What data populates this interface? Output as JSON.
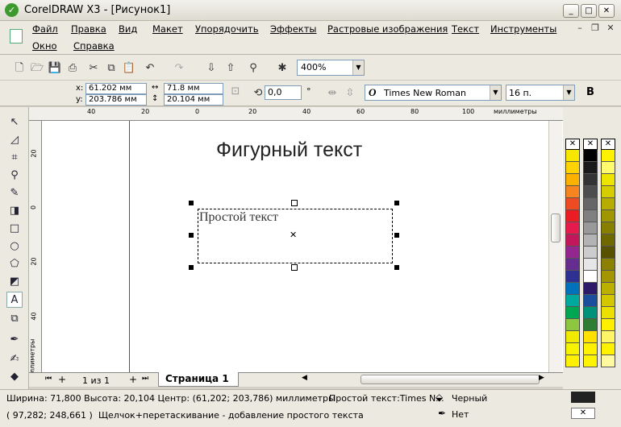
{
  "window": {
    "title": "CorelDRAW X3 - [Рисунок1]",
    "minimize": "_",
    "maximize": "□",
    "close": "✕"
  },
  "menu": [
    "Файл",
    "Правка",
    "Вид",
    "Макет",
    "Упорядочить",
    "Эффекты",
    "Растровые изображения",
    "Текст",
    "Инструменты",
    "Окно",
    "Справка"
  ],
  "toolbar": {
    "zoom": "400%"
  },
  "properties": {
    "x_label": "x:",
    "x": "61.202 мм",
    "y_label": "y:",
    "y": "203.786 мм",
    "w": "71.8 мм",
    "h": "20.104 мм",
    "angle": "0,0",
    "degree": "°",
    "font": "Times New Roman",
    "font_size": "16 п.",
    "bold": "B"
  },
  "ruler_top": {
    "ticks": [
      "40",
      "20",
      "0",
      "20",
      "40",
      "60",
      "80",
      "100"
    ],
    "unit": "миллиметры"
  },
  "ruler_left": {
    "ticks": [
      "20",
      "0",
      "20",
      "40"
    ],
    "unit": "миллиметры"
  },
  "document": {
    "artistic_text": "Фигурный текст",
    "paragraph_text": "Простой текст"
  },
  "pages": {
    "counter": "1 из 1",
    "tab": "Страница 1"
  },
  "status": {
    "line1": "Ширина: 71,800  Высота: 20,104  Центр: (61,202; 203,786)  миллиметры",
    "object": "Простой текст:Times N...",
    "fill": "Черный",
    "line2": "( 97,282; 248,661 )",
    "hint": "Щелчок+перетаскивание - добавление простого текста",
    "outline": "Нет"
  },
  "palette_colors": [
    [
      "#f7e600",
      "#ffd200",
      "#fbb100",
      "#f6841f",
      "#ef4b23",
      "#ec1c24",
      "#e51a4d",
      "#c2185b",
      "#93278f",
      "#662d91",
      "#2e3192",
      "#0072bc",
      "#00a99d",
      "#00a651",
      "#8dc63f",
      "#f2e900",
      "#f7f300",
      "#fff100"
    ],
    [
      "#000000",
      "#1a1a1a",
      "#333333",
      "#4d4d4d",
      "#666666",
      "#808080",
      "#999999",
      "#b3b3b3",
      "#cccccc",
      "#e6e6e6",
      "#ffffff",
      "#2e1a6b",
      "#1b4f9c",
      "#00917a",
      "#2e7d32",
      "#ffe100",
      "#fff200",
      "#fff400"
    ],
    [
      "#fff200",
      "#fffa6e",
      "#ede400",
      "#d6cd00",
      "#b7ad00",
      "#9f9600",
      "#877f00",
      "#6f6800",
      "#575100",
      "#8b8000",
      "#a39600",
      "#bbb000",
      "#d3c700",
      "#ebe000",
      "#fff000",
      "#fff566",
      "#fff200",
      "#fff9a0"
    ]
  ],
  "colors": {
    "canvas": "#ffffff",
    "chrome": "#ece9e0",
    "accent": "#3c9a2e"
  }
}
